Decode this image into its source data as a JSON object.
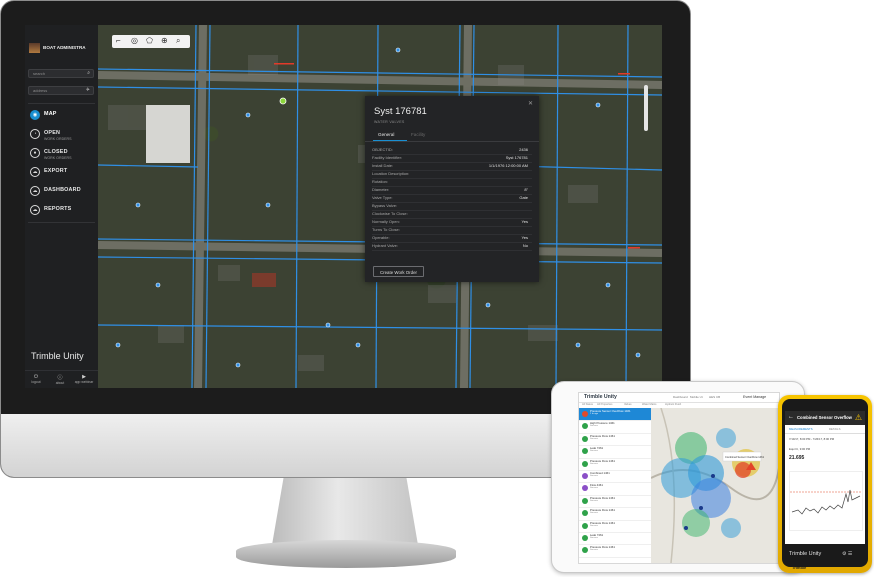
{
  "sidebar": {
    "org_title": "BOAT ADMINISTRA",
    "search_placeholder": "search",
    "address_placeholder": "address",
    "nav": [
      {
        "label": "MAP",
        "sub": "",
        "icon": "map-icon",
        "active": true
      },
      {
        "label": "OPEN",
        "sub": "WORK ORDERS",
        "icon": "open-work-orders-icon",
        "active": false
      },
      {
        "label": "CLOSED",
        "sub": "WORK ORDERS",
        "icon": "closed-work-orders-icon",
        "active": false
      },
      {
        "label": "EXPORT",
        "sub": "",
        "icon": "export-icon",
        "active": false
      },
      {
        "label": "DASHBOARD",
        "sub": "",
        "icon": "dashboard-icon",
        "active": false
      },
      {
        "label": "REPORTS",
        "sub": "",
        "icon": "reports-icon",
        "active": false
      }
    ],
    "brand": "Trimble Unity",
    "footer": [
      {
        "label": "logout",
        "icon": "power-icon"
      },
      {
        "label": "about",
        "icon": "info-icon"
      },
      {
        "label": "app webinar",
        "icon": "video-icon"
      }
    ]
  },
  "popup": {
    "title": "Syst 176781",
    "subtitle": "WATER VALVES",
    "tabs": [
      "General",
      "Facility"
    ],
    "active_tab": "General",
    "fields": [
      {
        "key": "OBJECTID:",
        "value": "2436"
      },
      {
        "key": "Facility Identifier:",
        "value": "Syst 176781"
      },
      {
        "key": "Install Date:",
        "value": "1/1/1976 12:00:00 AM"
      },
      {
        "key": "Location Description:",
        "value": ""
      },
      {
        "key": "Rotation:",
        "value": ""
      },
      {
        "key": "Diameter:",
        "value": "8\""
      },
      {
        "key": "Valve Type:",
        "value": "Gate"
      },
      {
        "key": "Bypass Valve:",
        "value": ""
      },
      {
        "key": "Clockwise To Close:",
        "value": ""
      },
      {
        "key": "Normally Open:",
        "value": "Yes"
      },
      {
        "key": "Turns To Close:",
        "value": ""
      },
      {
        "key": "Operable:",
        "value": "Yes"
      },
      {
        "key": "Hydrant Valve:",
        "value": "No"
      }
    ],
    "button": "Create Work Order"
  },
  "tablet": {
    "logo": "Trimble Unity",
    "header_tabs": [
      "Dashboard",
      "Mobile Ut",
      "HES CB"
    ],
    "title": "Event Manage",
    "subnav": [
      "All Status",
      "All Properties",
      "Valves",
      "Water Mains",
      "Hydrant Flush"
    ],
    "items": [
      {
        "title": "Pressure Sensor OverFlow 1461",
        "sub": "1 hr ago",
        "color": "#e04a2a",
        "sel": true
      },
      {
        "title": "High Pressure 1461",
        "sub": "Sensors",
        "color": "#2fa24a",
        "sel": false
      },
      {
        "title": "Pressure Flow 1461",
        "sub": "Sensors",
        "color": "#2fa24a",
        "sel": false
      },
      {
        "title": "Leak 7461",
        "sub": "Sensors",
        "color": "#2fa24a",
        "sel": false
      },
      {
        "title": "Pressure Flow 1461",
        "sub": "Sensors",
        "color": "#2fa24a",
        "sel": false
      },
      {
        "title": "Combined 1461",
        "sub": "Sensors",
        "color": "#8b4fc7",
        "sel": false
      },
      {
        "title": "Flow 4461",
        "sub": "Sensors",
        "color": "#8b4fc7",
        "sel": false
      },
      {
        "title": "Pressure Flow 1461",
        "sub": "Sensors",
        "color": "#2fa24a",
        "sel": false
      },
      {
        "title": "Pressure Flow 1461",
        "sub": "Sensors",
        "color": "#2fa24a",
        "sel": false
      },
      {
        "title": "Pressure Flow 1461",
        "sub": "Sensors",
        "color": "#2fa24a",
        "sel": false
      },
      {
        "title": "Leak 7461",
        "sub": "Sensors",
        "color": "#2fa24a",
        "sel": false
      },
      {
        "title": "Pressure Flow 1461",
        "sub": "Sensors",
        "color": "#2fa24a",
        "sel": false
      }
    ],
    "map_popup": "Combined Sensor OverFlow 1461"
  },
  "phone": {
    "title": "Combined Sensor Overflow",
    "tabs": [
      "MEASUREMENTS",
      "DETAILS"
    ],
    "active_tab": "MEASUREMENTS",
    "range": "7/19/17, 8:00 PM - 7/26/17, 8:00 PM",
    "reading_label": "Equi IC, 9:00 PM",
    "reading_value": "21.695",
    "brand": "Trimble Unity",
    "footer": "Trimble"
  }
}
